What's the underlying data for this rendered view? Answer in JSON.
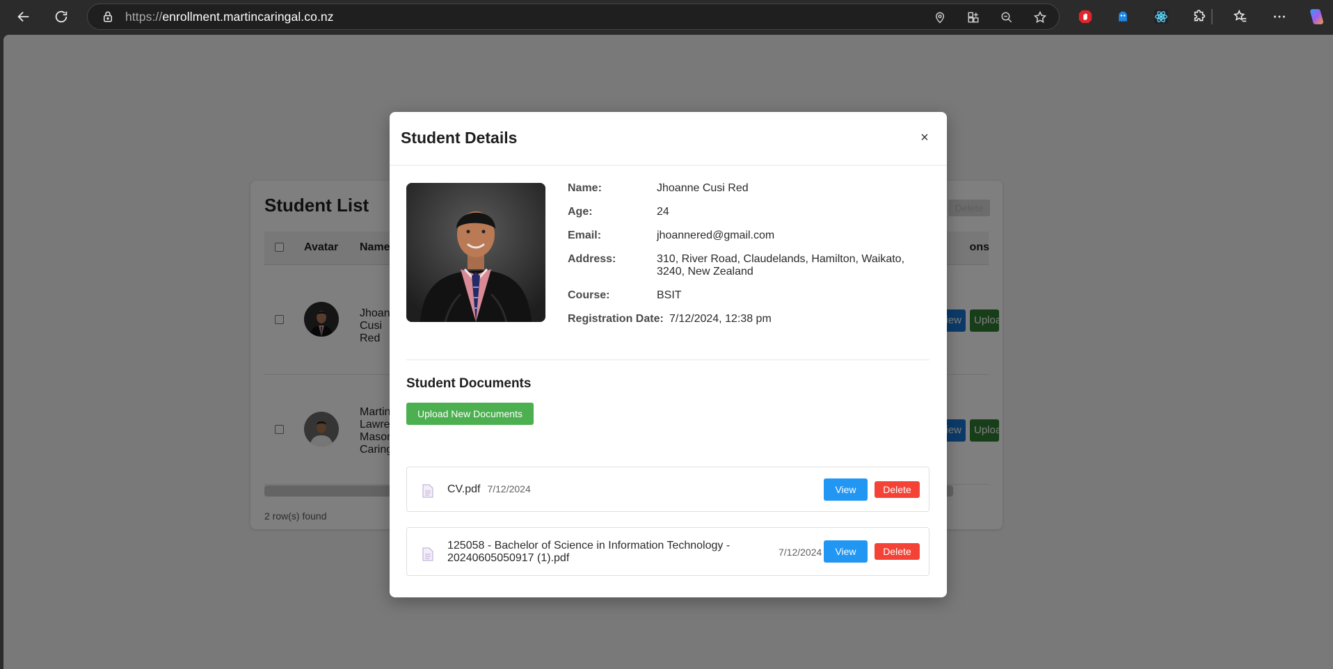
{
  "browser": {
    "url_scheme": "https://",
    "url_host": "enrollment.martincaringal.co.nz"
  },
  "background": {
    "list_title": "Student List",
    "delete_label": "Delete",
    "columns": {
      "avatar": "Avatar",
      "name": "Name",
      "actions": "ons"
    },
    "rows": [
      {
        "name": "Jhoanne Cusi Red",
        "view_label": "View",
        "upload_label": "Upload"
      },
      {
        "name": "Martin Lawrence Mason Caringal",
        "view_label": "View",
        "upload_label": "Upload"
      }
    ],
    "rows_found": "2 row(s) found"
  },
  "modal": {
    "title": "Student Details",
    "close_label": "×",
    "details": [
      {
        "label": "Name:",
        "value": "Jhoanne Cusi Red"
      },
      {
        "label": "Age:",
        "value": "24"
      },
      {
        "label": "Email:",
        "value": "jhoannered@gmail.com"
      },
      {
        "label": "Address:",
        "value": "310, River Road, Claudelands, Hamilton, Waikato, 3240, New Zealand"
      },
      {
        "label": "Course:",
        "value": "BSIT"
      },
      {
        "label": "Registration Date:",
        "value": "7/12/2024, 12:38 pm"
      }
    ],
    "documents_title": "Student Documents",
    "upload_label": "Upload New Documents",
    "documents": [
      {
        "name": "CV.pdf",
        "date": "7/12/2024",
        "view_label": "View",
        "delete_label": "Delete"
      },
      {
        "name": "125058 - Bachelor of Science in Information Technology - 20240605050917 (1).pdf",
        "date": "7/12/2024",
        "view_label": "View",
        "delete_label": "Delete"
      }
    ]
  },
  "colors": {
    "view_button": "#2196f3",
    "delete_button": "#f44336",
    "upload_button": "#4caf50"
  }
}
